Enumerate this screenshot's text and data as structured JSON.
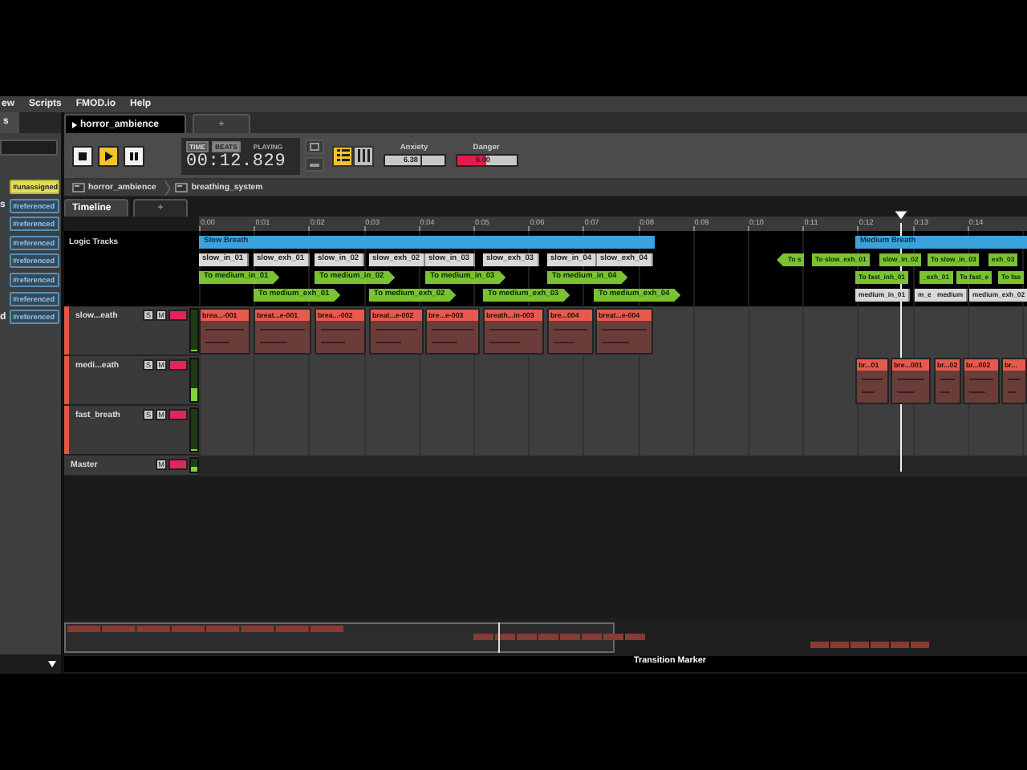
{
  "menu": [
    "ew",
    "Scripts",
    "FMOD.io",
    "Help"
  ],
  "sidebar": {
    "tab": "s",
    "tags": [
      {
        "label": "#unassigned",
        "kind": "unassigned"
      },
      {
        "label": "#referenced",
        "kind": "referenced",
        "prefix": "s"
      },
      {
        "label": "#referenced",
        "kind": "referenced"
      },
      {
        "label": "#referenced",
        "kind": "referenced"
      },
      {
        "label": "#referenced",
        "kind": "referenced"
      },
      {
        "label": "#referenced",
        "kind": "referenced"
      },
      {
        "label": "#referenced",
        "kind": "referenced"
      },
      {
        "label": "#referenced",
        "kind": "referenced",
        "prefix": "d"
      }
    ]
  },
  "editor_tabs": [
    {
      "label": "horror_ambience",
      "selected": true
    },
    {
      "label": "+",
      "selected": false
    }
  ],
  "transport": {
    "buttons": [
      {
        "kind": "stop",
        "selected": false
      },
      {
        "kind": "play",
        "selected": true
      },
      {
        "kind": "pause",
        "selected": false
      }
    ],
    "modes": [
      {
        "label": "TIME",
        "selected": false
      },
      {
        "label": "BEATS",
        "selected": true
      }
    ],
    "state": "PLAYING",
    "time": "00:12.829",
    "views": [
      {
        "kind": "list",
        "selected": true
      },
      {
        "kind": "grid",
        "selected": false
      }
    ],
    "parameters": [
      {
        "name": "Anxiety",
        "value": "6.38",
        "level": 0.64,
        "kind": "normal"
      },
      {
        "name": "Danger",
        "value": "5.00",
        "level": 0.5,
        "kind": "alert"
      }
    ]
  },
  "breadcrumb": [
    "horror_ambience",
    "breathing_system"
  ],
  "timeline_tabs": [
    {
      "label": "Timeline",
      "selected": true
    },
    {
      "label": "+",
      "selected": false
    }
  ],
  "ruler": [
    "0:00",
    "0:01",
    "0:02",
    "0:03",
    "0:04",
    "0:05",
    "0:06",
    "0:07",
    "0:08",
    "0:09",
    "0:10",
    "0:11",
    "0:12",
    "0:13",
    "0:14"
  ],
  "logic_tracks": {
    "label": "Logic Tracks",
    "regions": [
      {
        "label": "Slow Breath"
      },
      {
        "label": "Medium Breath"
      }
    ],
    "markers": [
      {
        "label": "slow_in_01"
      },
      {
        "label": "slow_exh_01"
      },
      {
        "label": "slow_in_02"
      },
      {
        "label": "slow_exh_02"
      },
      {
        "label": "slow_in_03"
      },
      {
        "label": "slow_exh_03"
      },
      {
        "label": "slow_in_04"
      },
      {
        "label": "slow_exh_04"
      },
      {
        "label": "medium_in_01"
      },
      {
        "label": "m_e"
      },
      {
        "label": "medium"
      },
      {
        "label": "medium_exh_02"
      }
    ],
    "transitions": [
      {
        "label": "To s",
        "kind": "arrow_left"
      },
      {
        "label": "To slow_exh_01",
        "kind": "plain"
      },
      {
        "label": "slow_in_02",
        "kind": "plain"
      },
      {
        "label": "To slow_in_03",
        "kind": "plain"
      },
      {
        "label": "exh_03",
        "kind": "plain"
      },
      {
        "label": "To medium_in_01",
        "kind": "arrow_right"
      },
      {
        "label": "To medium_in_02",
        "kind": "arrow_right"
      },
      {
        "label": "To medium_in_03",
        "kind": "arrow_right"
      },
      {
        "label": "To medium_in_04",
        "kind": "arrow_right"
      },
      {
        "label": "To fast_inh_01",
        "kind": "plain"
      },
      {
        "label": "_exh_01",
        "kind": "plain"
      },
      {
        "label": "To fast_e",
        "kind": "plain"
      },
      {
        "label": "To fas",
        "kind": "plain"
      },
      {
        "label": "To medium_exh_01",
        "kind": "arrow_right"
      },
      {
        "label": "To medium_exh_02",
        "kind": "arrow_right"
      },
      {
        "label": "To medium_exh_03",
        "kind": "arrow_right"
      },
      {
        "label": "To medium_exh_04",
        "kind": "arrow_right"
      }
    ]
  },
  "tracks": [
    {
      "name": "slow...eath",
      "kind": "audio",
      "buttons": [
        "S",
        "M"
      ],
      "level": 0.05,
      "instruments": [
        "brea...-001",
        "breat...e-001",
        "brea...-002",
        "breat...e-002",
        "bre...e-003",
        "breath...in-003",
        "bre...004",
        "breat...e-004"
      ]
    },
    {
      "name": "medi...eath",
      "kind": "audio",
      "buttons": [
        "S",
        "M"
      ],
      "level": 0.3,
      "instruments": [
        "br...01",
        "bre...001",
        "br...02",
        "br...002",
        "br..."
      ]
    },
    {
      "name": "fast_breath",
      "kind": "audio",
      "buttons": [
        "S",
        "M"
      ],
      "level": 0.05
    },
    {
      "name": "Master",
      "kind": "master",
      "buttons": [
        "M"
      ],
      "level": 0.4
    }
  ],
  "status": "Transition Marker"
}
